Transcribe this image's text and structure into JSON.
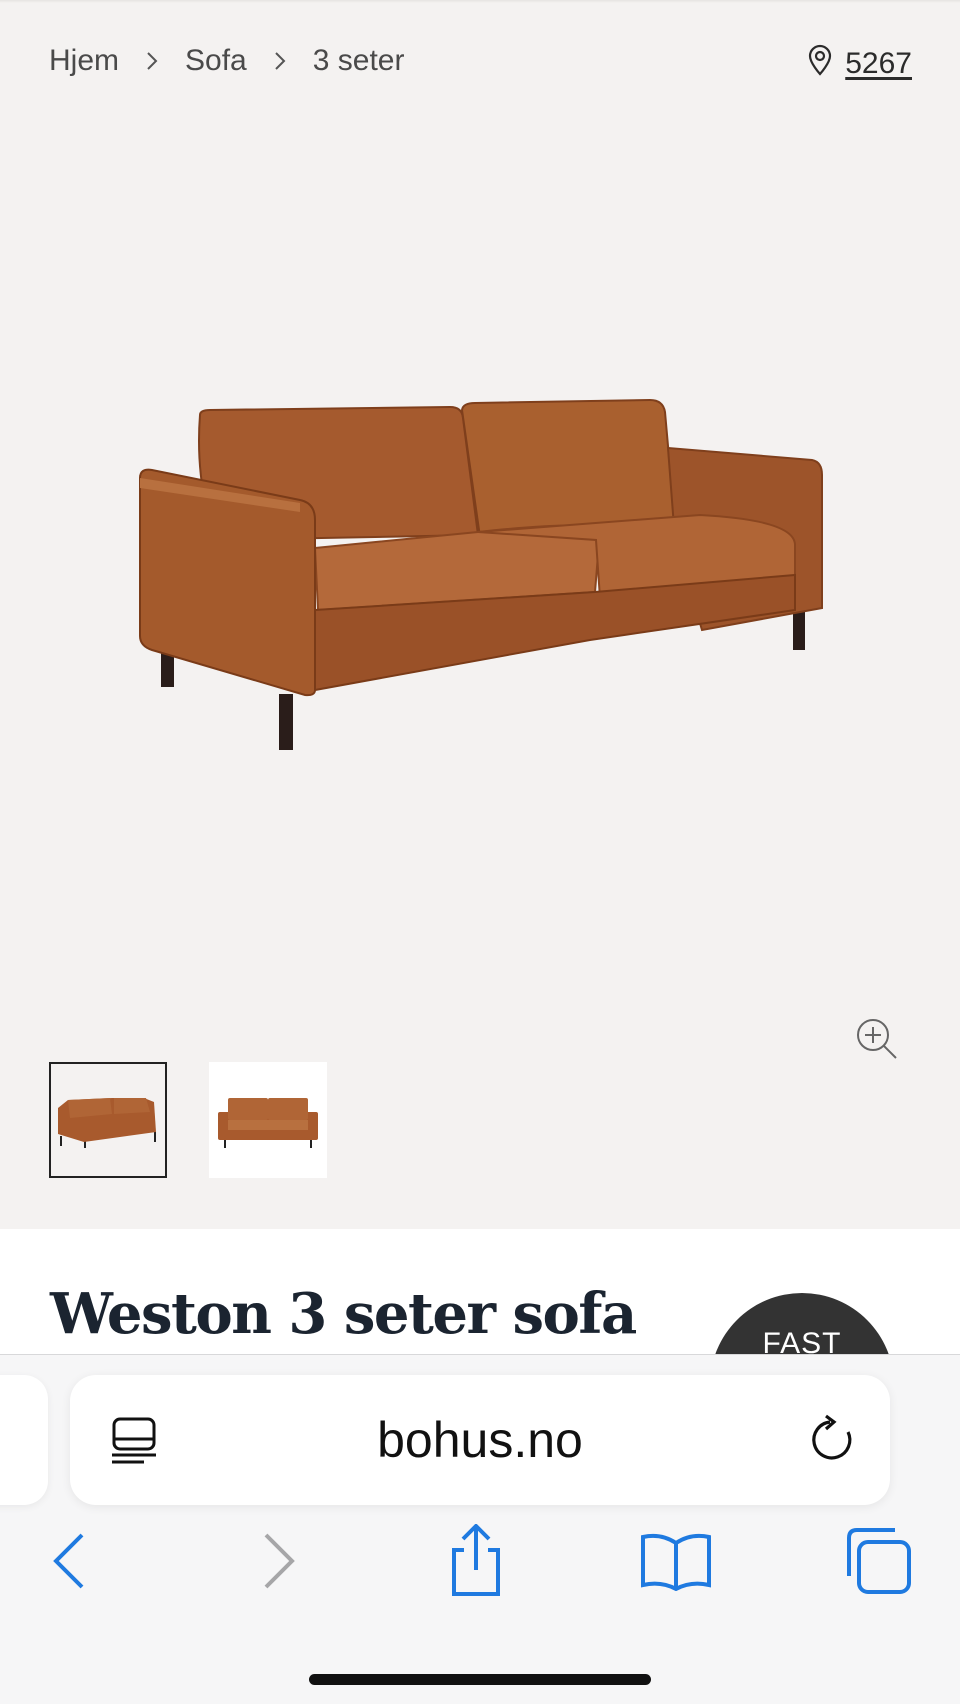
{
  "breadcrumb": {
    "items": [
      "Hjem",
      "Sofa",
      "3 seter"
    ]
  },
  "location": {
    "icon": "map-pin-icon",
    "code": "5267"
  },
  "gallery": {
    "main_image": "sofa-image",
    "zoom_icon": "zoom-in-icon",
    "thumbnail_count": 2
  },
  "product": {
    "title": "Weston 3 seter sofa",
    "badge": "FAST"
  },
  "browser": {
    "url": "bohus.no",
    "reader_icon": "reader-mode-icon",
    "reload_icon": "reload-icon",
    "toolbar": [
      "back-icon",
      "forward-icon",
      "share-icon",
      "bookmarks-icon",
      "tabs-icon"
    ]
  },
  "colors": {
    "page_bg": "#f4f2f1",
    "leather": "#a85a2d",
    "ios_blue": "#1f7ae0",
    "badge_bg": "#333333"
  }
}
